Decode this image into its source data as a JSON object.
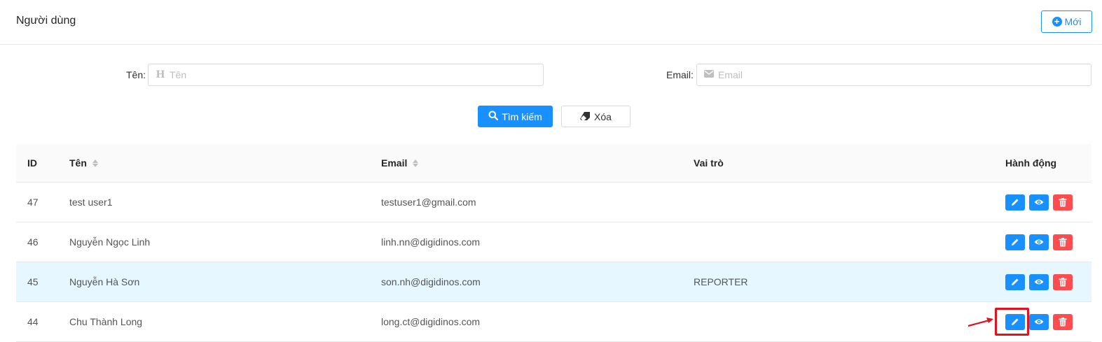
{
  "header": {
    "title": "Người dùng",
    "new_button_label": "Mới"
  },
  "filters": {
    "name_label": "Tên",
    "name_placeholder": "Tên",
    "email_label": "Email",
    "email_placeholder": "Email",
    "search_button": "Tìm kiếm",
    "clear_button": "Xóa"
  },
  "table": {
    "columns": [
      "ID",
      "Tên",
      "Email",
      "Vai trò",
      "Hành động"
    ],
    "rows": [
      {
        "id": "47",
        "name": "test user1",
        "email": "testuser1@gmail.com",
        "role": ""
      },
      {
        "id": "46",
        "name": "Nguyễn Ngọc Linh",
        "email": "linh.nn@digidinos.com",
        "role": ""
      },
      {
        "id": "45",
        "name": "Nguyễn Hà Sơn",
        "email": "son.nh@digidinos.com",
        "role": "REPORTER"
      },
      {
        "id": "44",
        "name": "Chu Thành Long",
        "email": "long.ct@digidinos.com",
        "role": ""
      }
    ]
  },
  "icons": {
    "new": "plus-circle-icon",
    "name_field": "heading-icon",
    "email_field": "envelope-icon",
    "search": "search-icon",
    "clear": "eraser-icon",
    "edit": "pencil-icon",
    "view": "eye-icon",
    "delete": "trash-icon"
  },
  "colors": {
    "primary": "#1890ff",
    "danger": "#ff4d4f",
    "row_highlight": "#e6f7ff",
    "annotation": "#e0141e"
  }
}
